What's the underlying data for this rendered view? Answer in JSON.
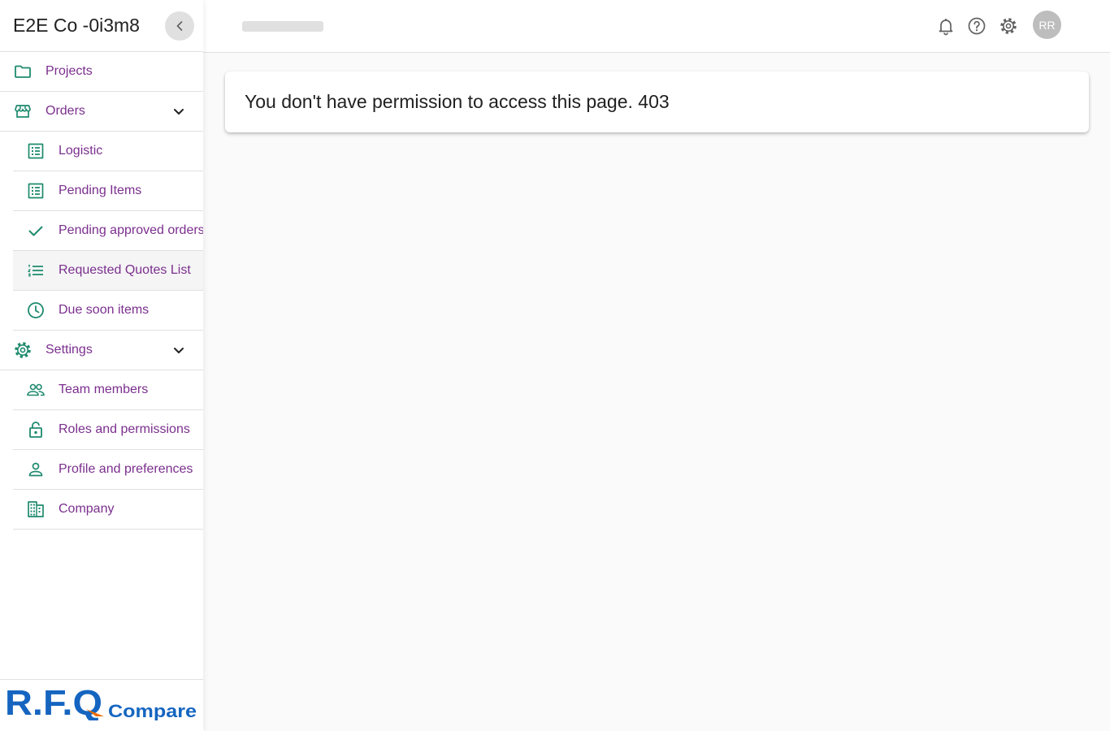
{
  "app": {
    "company_name": "E2E Co -0i3m8"
  },
  "sidebar": {
    "items": [
      {
        "label": "Projects",
        "icon": "folder-icon"
      },
      {
        "label": "Orders",
        "icon": "storefront-icon",
        "expanded": true
      },
      {
        "label": "Logistic",
        "icon": "list-alt-icon"
      },
      {
        "label": "Pending Items",
        "icon": "list-alt-icon"
      },
      {
        "label": "Pending approved orders",
        "icon": "check-icon"
      },
      {
        "label": "Requested Quotes List",
        "icon": "format-list-numbered-icon",
        "active": true
      },
      {
        "label": "Due soon items",
        "icon": "clock-icon"
      },
      {
        "label": "Settings",
        "icon": "gear-icon",
        "expanded": true
      },
      {
        "label": "Team members",
        "icon": "people-icon"
      },
      {
        "label": "Roles and permissions",
        "icon": "lock-icon"
      },
      {
        "label": "Profile and preferences",
        "icon": "person-icon"
      },
      {
        "label": "Company",
        "icon": "building-icon"
      }
    ]
  },
  "logo": {
    "part1": "R.F.Q",
    "part2": "Compare"
  },
  "header": {
    "avatar_initials": "RR"
  },
  "main": {
    "message": "You don't have permission to access this page. 403"
  },
  "colors": {
    "nav_text": "#7b2f8e",
    "icon": "#1e8a6e",
    "logo_blue": "#1565c0",
    "logo_orange": "#ef6c00"
  }
}
